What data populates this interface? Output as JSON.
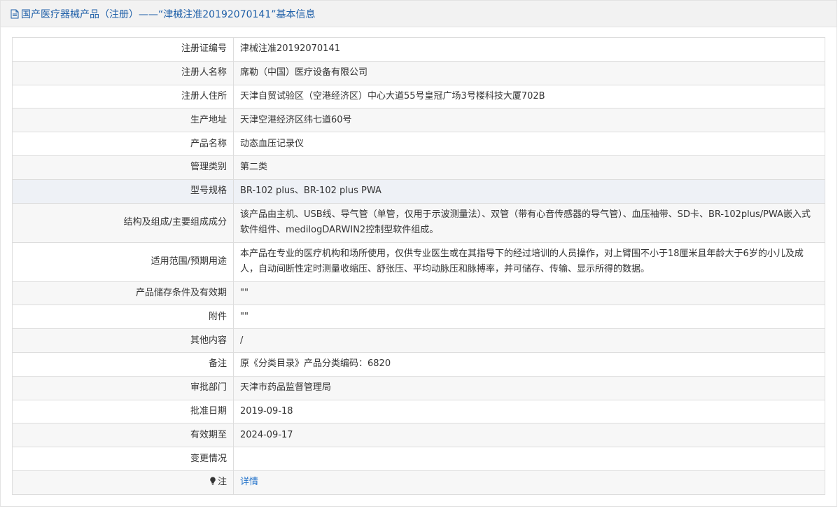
{
  "header": {
    "title": "国产医疗器械产品（注册）——“津械注准20192070141”基本信息"
  },
  "rows": [
    {
      "label": "注册证编号",
      "value": "津械注准20192070141"
    },
    {
      "label": "注册人名称",
      "value": "席勒（中国）医疗设备有限公司"
    },
    {
      "label": "注册人住所",
      "value": "天津自贸试验区（空港经济区）中心大道55号皇冠广场3号楼科技大厦702B"
    },
    {
      "label": "生产地址",
      "value": "天津空港经济区纬七道60号"
    },
    {
      "label": "产品名称",
      "value": "动态血压记录仪"
    },
    {
      "label": "管理类别",
      "value": "第二类"
    },
    {
      "label": "型号规格",
      "value": "BR-102 plus、BR-102 plus PWA"
    },
    {
      "label": "结构及组成/主要组成成分",
      "value": "该产品由主机、USB线、导气管（单管，仅用于示波测量法）、双管（带有心音传感器的导气管）、血压袖带、SD卡、BR-102plus/PWA嵌入式软件组件、medilogDARWIN2控制型软件组成。"
    },
    {
      "label": "适用范围/预期用途",
      "value": "本产品在专业的医疗机构和场所使用，仅供专业医生或在其指导下的经过培训的人员操作，对上臂围不小于18厘米且年龄大于6岁的小儿及成人，自动间断性定时测量收缩压、舒张压、平均动脉压和脉搏率，并可储存、传输、显示所得的数据。"
    },
    {
      "label": "产品储存条件及有效期",
      "value": "\"\""
    },
    {
      "label": "附件",
      "value": "\"\""
    },
    {
      "label": "其他内容",
      "value": "/"
    },
    {
      "label": "备注",
      "value": "原《分类目录》产品分类编码：6820"
    },
    {
      "label": "审批部门",
      "value": "天津市药品监督管理局"
    },
    {
      "label": "批准日期",
      "value": "2019-09-18"
    },
    {
      "label": "有效期至",
      "value": "2024-09-17"
    },
    {
      "label": "变更情况",
      "value": ""
    }
  ],
  "note_row": {
    "label": "注",
    "link": "详情",
    "icon": "lightbulb-icon"
  },
  "colors": {
    "title": "#1e5fa8",
    "link": "#1e6fc8",
    "header_bg": "#f2f2f2",
    "row_alt": "#f7f7f7",
    "row_highlight": "#eef1f6"
  }
}
